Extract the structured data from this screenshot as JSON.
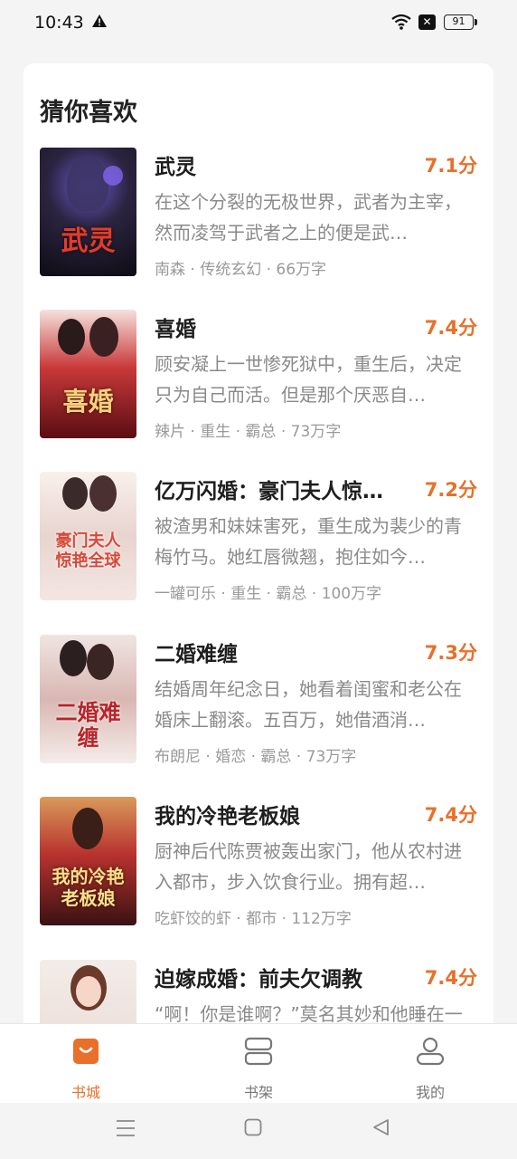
{
  "status_bar": {
    "time": "10:43",
    "battery": "91"
  },
  "section": {
    "title": "猜你喜欢"
  },
  "books": [
    {
      "title": "武灵",
      "score": "7.1分",
      "description": "在这个分裂的无极世界，武者为主宰，然而凌驾于武者之上的便是武…",
      "meta": "南森 · 传统玄幻 · 66万字",
      "cover_text": "武灵"
    },
    {
      "title": "喜婚",
      "score": "7.4分",
      "description": "顾安凝上一世惨死狱中，重生后，决定只为自己而活。但是那个厌恶自…",
      "meta": "辣片 · 重生 · 霸总 · 73万字",
      "cover_text": "喜婚"
    },
    {
      "title": "亿万闪婚：豪门夫人惊…",
      "score": "7.2分",
      "description": "被渣男和妹妹害死，重生成为裴少的青梅竹马。她红唇微翘，抱住如今…",
      "meta": "一罐可乐 · 重生 · 霸总 · 100万字",
      "cover_text": "豪门夫人惊艳全球"
    },
    {
      "title": "二婚难缠",
      "score": "7.3分",
      "description": "结婚周年纪念日，她看着闺蜜和老公在婚床上翻滚。五百万，她借酒消…",
      "meta": "布朗尼 · 婚恋 · 霸总 · 73万字",
      "cover_text": "二婚难缠"
    },
    {
      "title": "我的冷艳老板娘",
      "score": "7.4分",
      "description": "厨神后代陈贾被轰出家门，他从农村进入都市，步入饮食行业。拥有超…",
      "meta": "吃虾饺的虾 · 都市 · 112万字",
      "cover_text": "我的冷艳老板娘"
    },
    {
      "title": "迫嫁成婚：前夫欠调教",
      "score": "7.4分",
      "description": "“啊！你是谁啊？”莫名其妙和他睡在一起…",
      "meta": "",
      "cover_text": ""
    }
  ],
  "bottom_nav": [
    {
      "label": "书城",
      "icon": "bookstore-bag-icon",
      "active": true
    },
    {
      "label": "书架",
      "icon": "bookshelf-icon",
      "active": false
    },
    {
      "label": "我的",
      "icon": "profile-icon",
      "active": false
    }
  ],
  "colors": {
    "accent": "#e8702a",
    "background": "#f4f4f4",
    "card": "#ffffff"
  }
}
